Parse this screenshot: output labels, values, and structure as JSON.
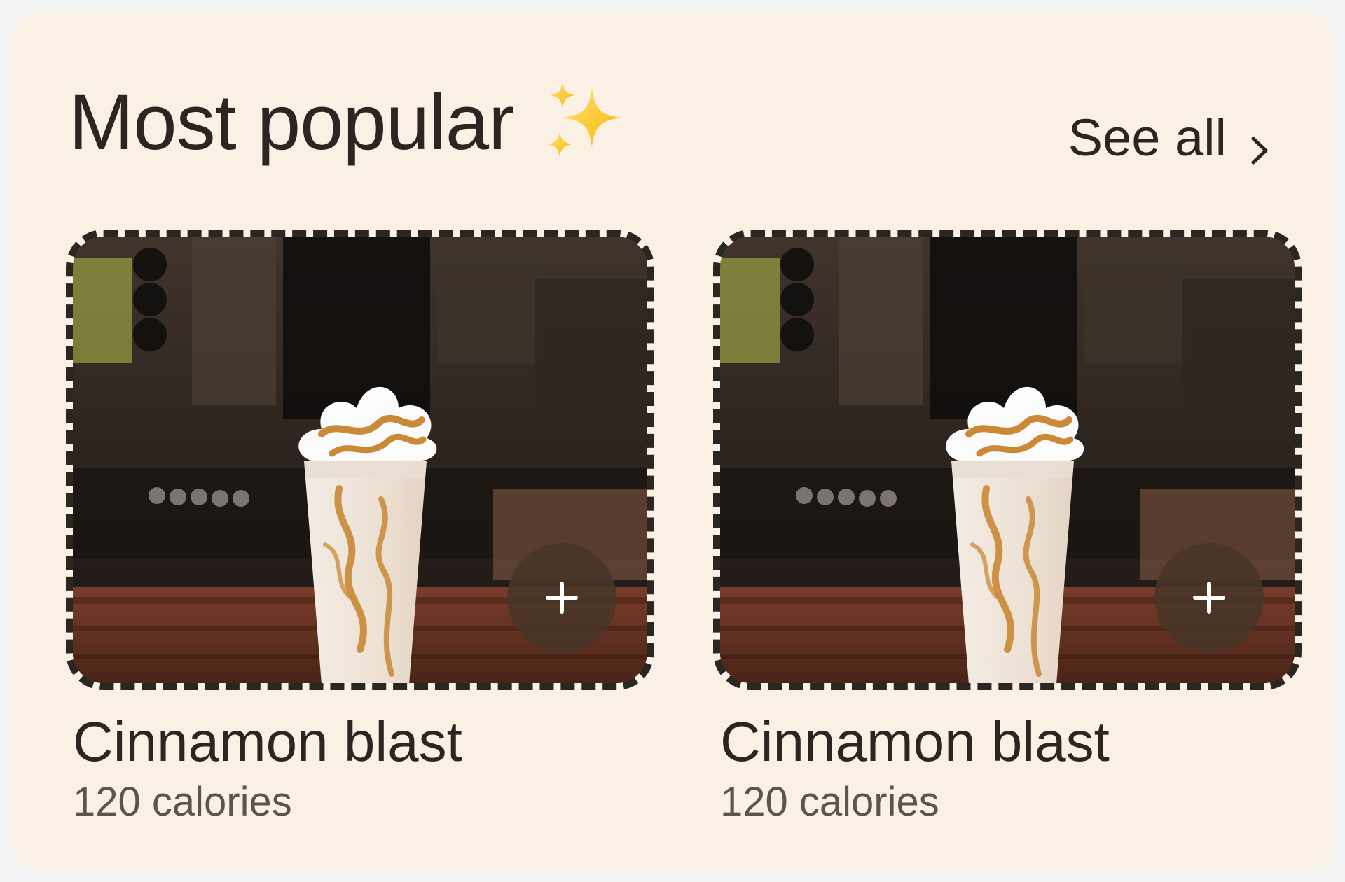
{
  "section": {
    "title": "Most popular",
    "see_all_label": "See all",
    "icons": {
      "sparkles": "sparkles-icon",
      "chevron": "chevron-right-icon"
    }
  },
  "products": [
    {
      "name": "Cinnamon blast",
      "calories": "120 calories",
      "image": "drink-photo",
      "add_icon": "plus-icon"
    },
    {
      "name": "Cinnamon blast",
      "calories": "120 calories",
      "image": "drink-photo",
      "add_icon": "plus-icon"
    }
  ],
  "colors": {
    "panel_bg": "#fbf0e4",
    "text_primary": "#2b2622",
    "text_secondary": "#5c544d",
    "dashed_border": "#2a2622",
    "add_button_bg": "#483628",
    "sparkles": "#f7c21a"
  }
}
